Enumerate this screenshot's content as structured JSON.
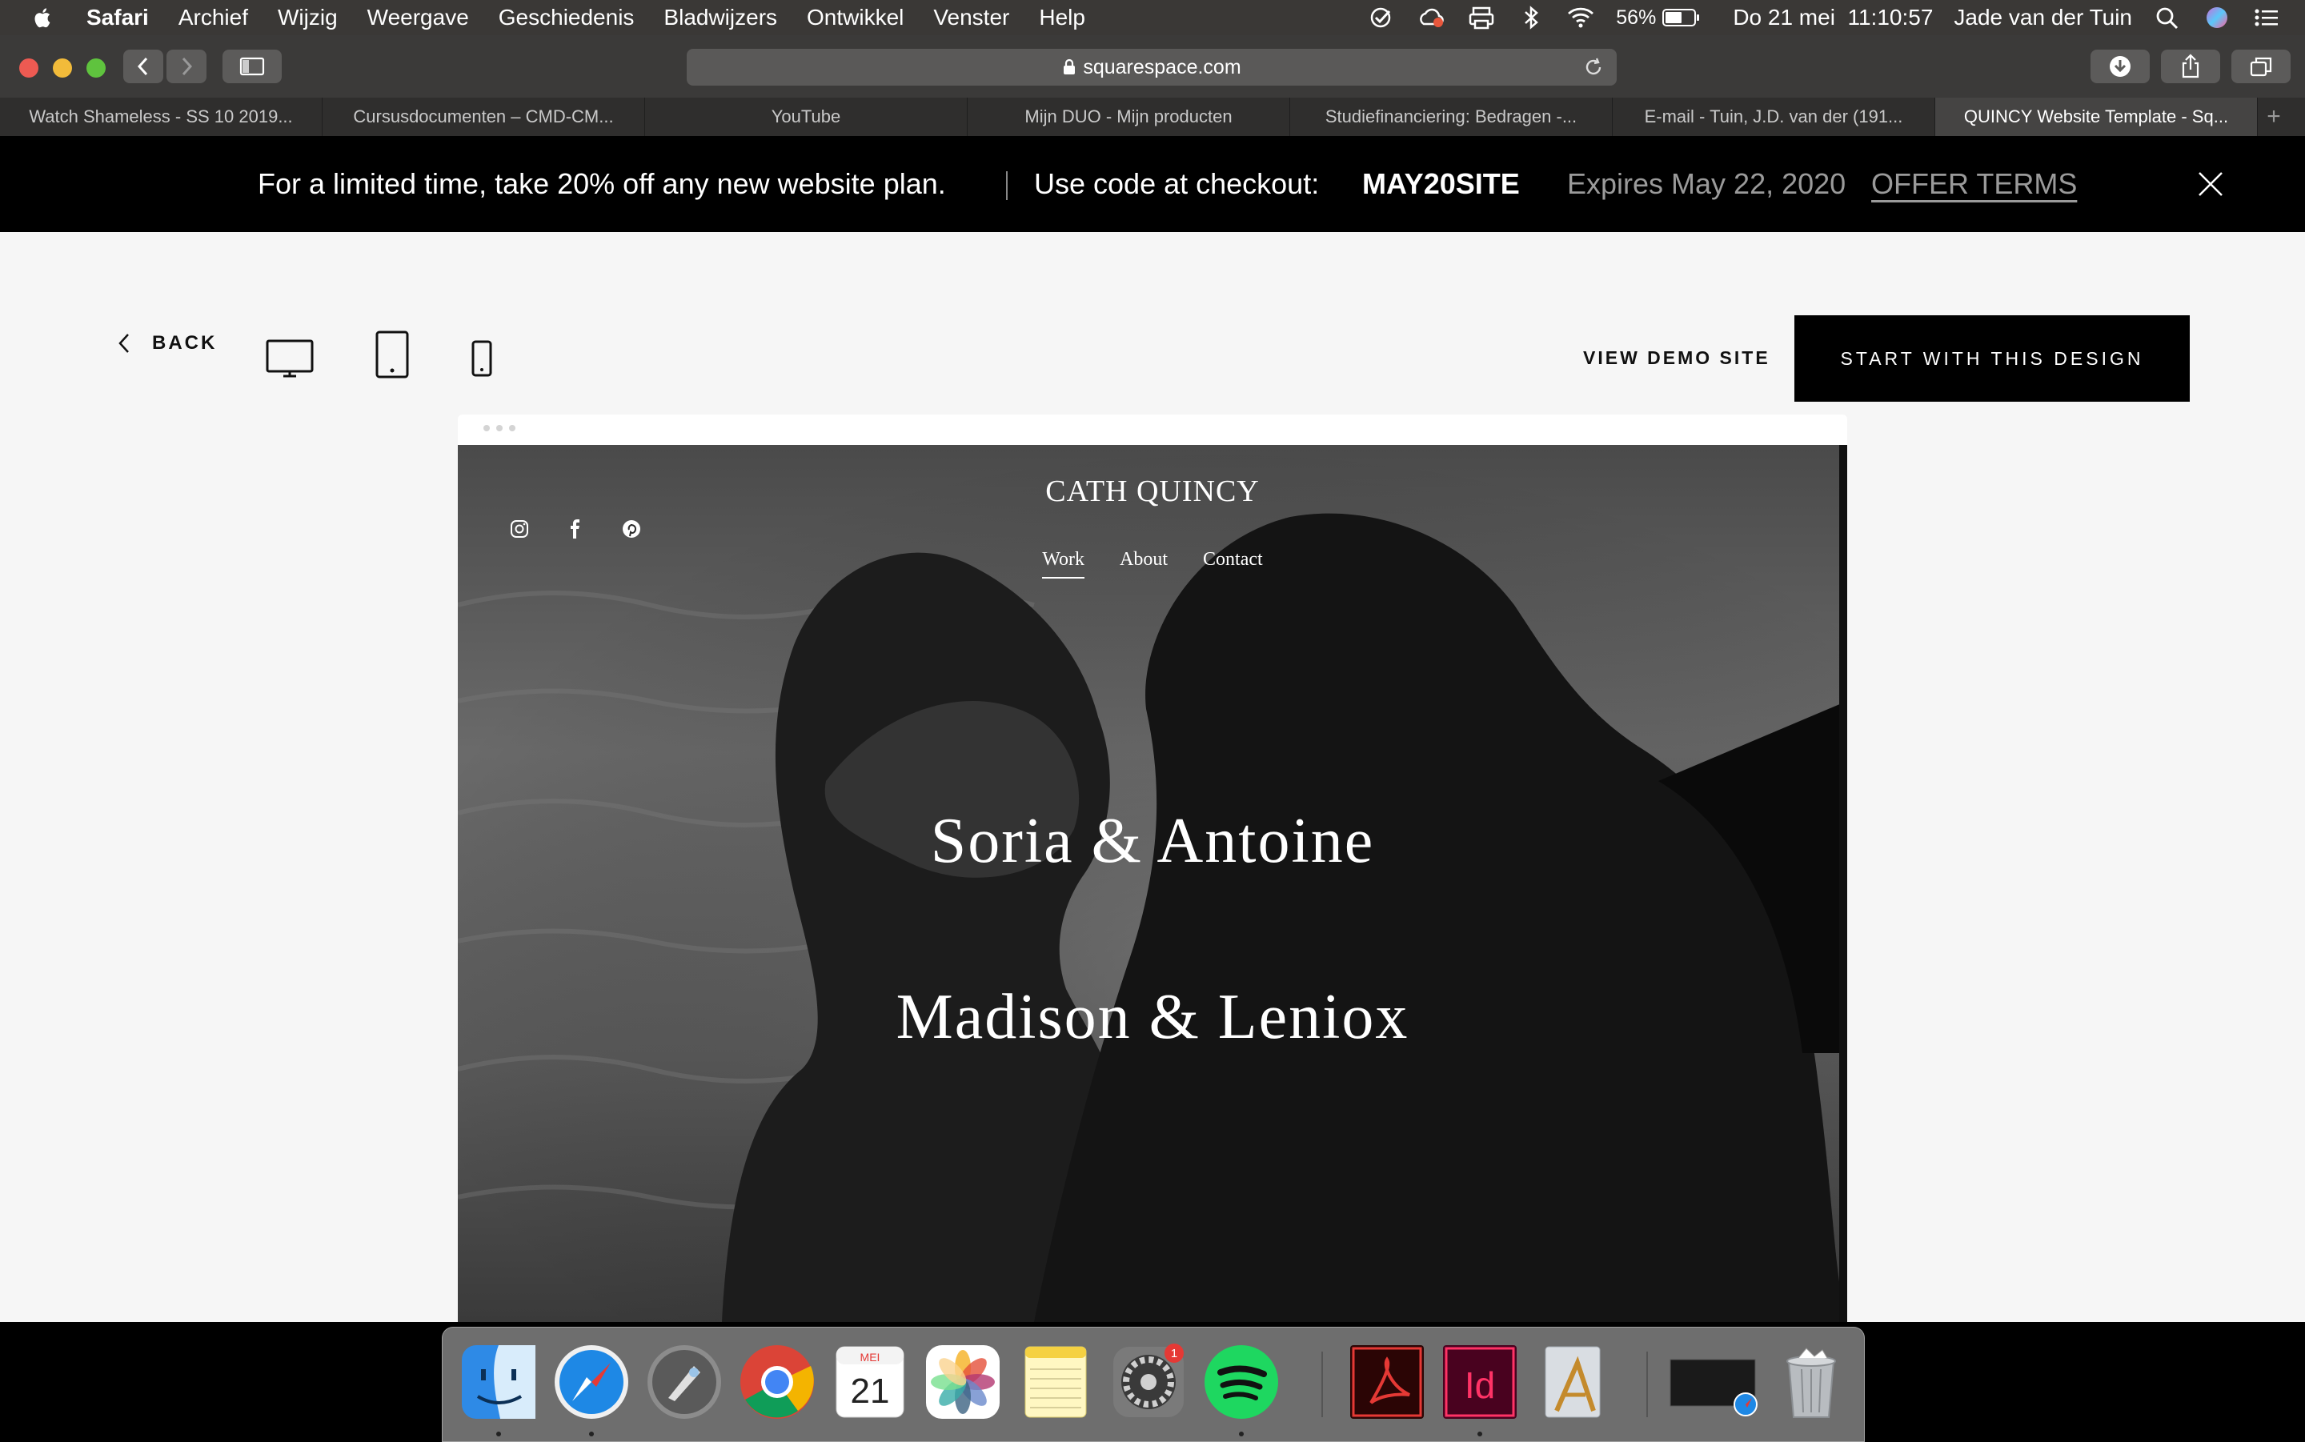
{
  "menubar": {
    "app": "Safari",
    "items": [
      "Archief",
      "Wijzig",
      "Weergave",
      "Geschiedenis",
      "Bladwijzers",
      "Ontwikkel",
      "Venster",
      "Help"
    ],
    "battery": "56%",
    "datetime": "Do 21 mei  11:10:57",
    "user": "Jade van der Tuin"
  },
  "browser": {
    "url": "squarespace.com",
    "tabs": [
      "Watch Shameless - SS 10 2019...",
      "Cursusdocumenten – CMD-CM...",
      "YouTube",
      "Mijn DUO - Mijn producten",
      "Studiefinanciering: Bedragen -...",
      "E-mail - Tuin, J.D. van der (191...",
      "QUINCY Website Template - Sq..."
    ],
    "active_tab_index": 6
  },
  "promo": {
    "text": "For a limited time, take 20% off any new website plan.",
    "code_label": "Use code at checkout:",
    "code": "MAY20SITE",
    "expires": "Expires May 22, 2020",
    "terms": "OFFER TERMS"
  },
  "controls": {
    "back": "BACK",
    "view_demo": "VIEW DEMO SITE",
    "start": "START WITH THIS DESIGN"
  },
  "site": {
    "title": "CATH QUINCY",
    "nav": [
      "Work",
      "About",
      "Contact"
    ],
    "projects": [
      "Soria & Antoine",
      "Madison & Leniox"
    ]
  },
  "dock": {
    "calendar_month": "MEI",
    "calendar_day": "21",
    "badge": "1"
  },
  "colors": {
    "promo_bg": "#000000",
    "cta_bg": "#000000",
    "page_bg": "#f6f6f6"
  }
}
